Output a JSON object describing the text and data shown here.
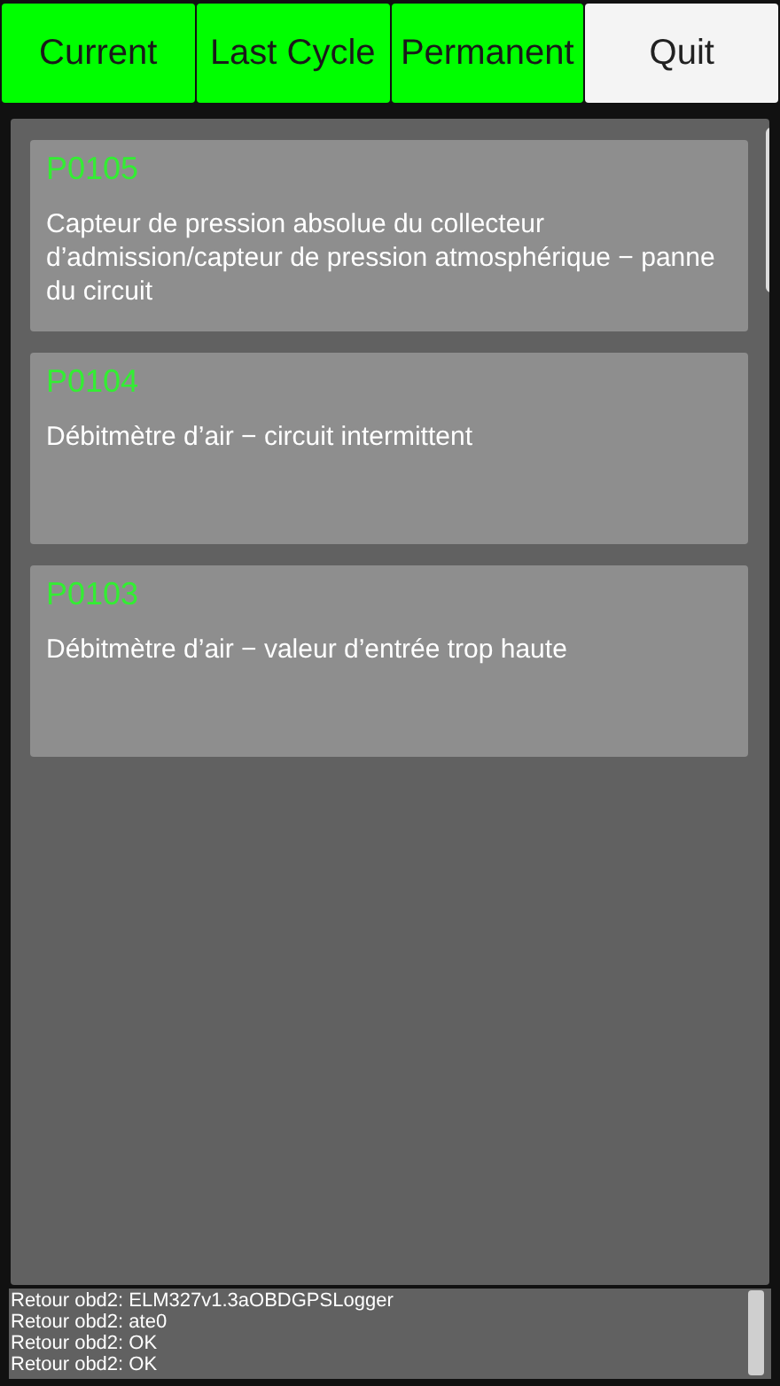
{
  "buttons": [
    {
      "label": "Current",
      "kind": "mode"
    },
    {
      "label": "Last Cycle",
      "kind": "mode"
    },
    {
      "label": "Permanent",
      "kind": "mode"
    },
    {
      "label": "Quit",
      "kind": "quit"
    }
  ],
  "codes": [
    {
      "code": "P0105",
      "description": "Capteur de pression absolue du collecteur d’admission/capteur de pression atmosphérique − panne du circuit"
    },
    {
      "code": "P0104",
      "description": "Débitmètre d’air − circuit intermittent"
    },
    {
      "code": "P0103",
      "description": "Débitmètre d’air − valeur d’entrée trop haute"
    }
  ],
  "log": [
    "Retour obd2: ELM327v1.3aOBDGPSLogger",
    "Retour obd2: ate0",
    "Retour obd2: OK",
    "Retour obd2: OK"
  ]
}
